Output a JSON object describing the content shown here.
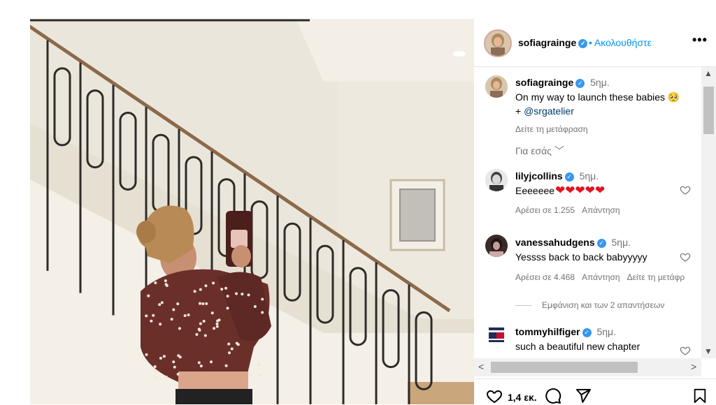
{
  "post": {
    "author": "sofiagrainge",
    "follow_label": "Ακολουθήστε",
    "more_label": "•••",
    "verified_mark": "✓"
  },
  "caption": {
    "username": "sofiagrainge",
    "time": "5ημ.",
    "text": "On my way to launch these babies 🥺",
    "plus": "+ ",
    "mention": "@srgatelier",
    "translate": "Δείτε τη μετάφραση"
  },
  "for_you": "Για εσάς ﹀",
  "comments": [
    {
      "username": "lilyjcollins",
      "time": "5ημ.",
      "text": "Eeeeeee",
      "hearts": "❤❤❤❤❤",
      "likes": "Αρέσει σε 1.255",
      "reply": "Απάντηση",
      "translate": ""
    },
    {
      "username": "vanessahudgens",
      "time": "5ημ.",
      "text": "Yessss back to back babyyyyy",
      "hearts": "",
      "likes": "Αρέσει σε 4.468",
      "reply": "Απάντηση",
      "translate": "Δείτε τη μετάφρ"
    },
    {
      "username": "tommyhilfiger",
      "time": "5ημ.",
      "text": "such a beautiful new chapter",
      "hearts": "",
      "likes": "",
      "reply": "",
      "translate": ""
    }
  ],
  "view_replies": "Εμφάνιση και των 2 απαντήσεων",
  "footer": {
    "likes_count": "1,4 εκ."
  },
  "colors": {
    "link": "#0095f6",
    "verified": "#3897f0",
    "heart": "#e0151f"
  },
  "icons": [
    "heart-icon",
    "comment-icon",
    "share-icon",
    "bookmark-icon",
    "more-icon",
    "verified-icon"
  ]
}
